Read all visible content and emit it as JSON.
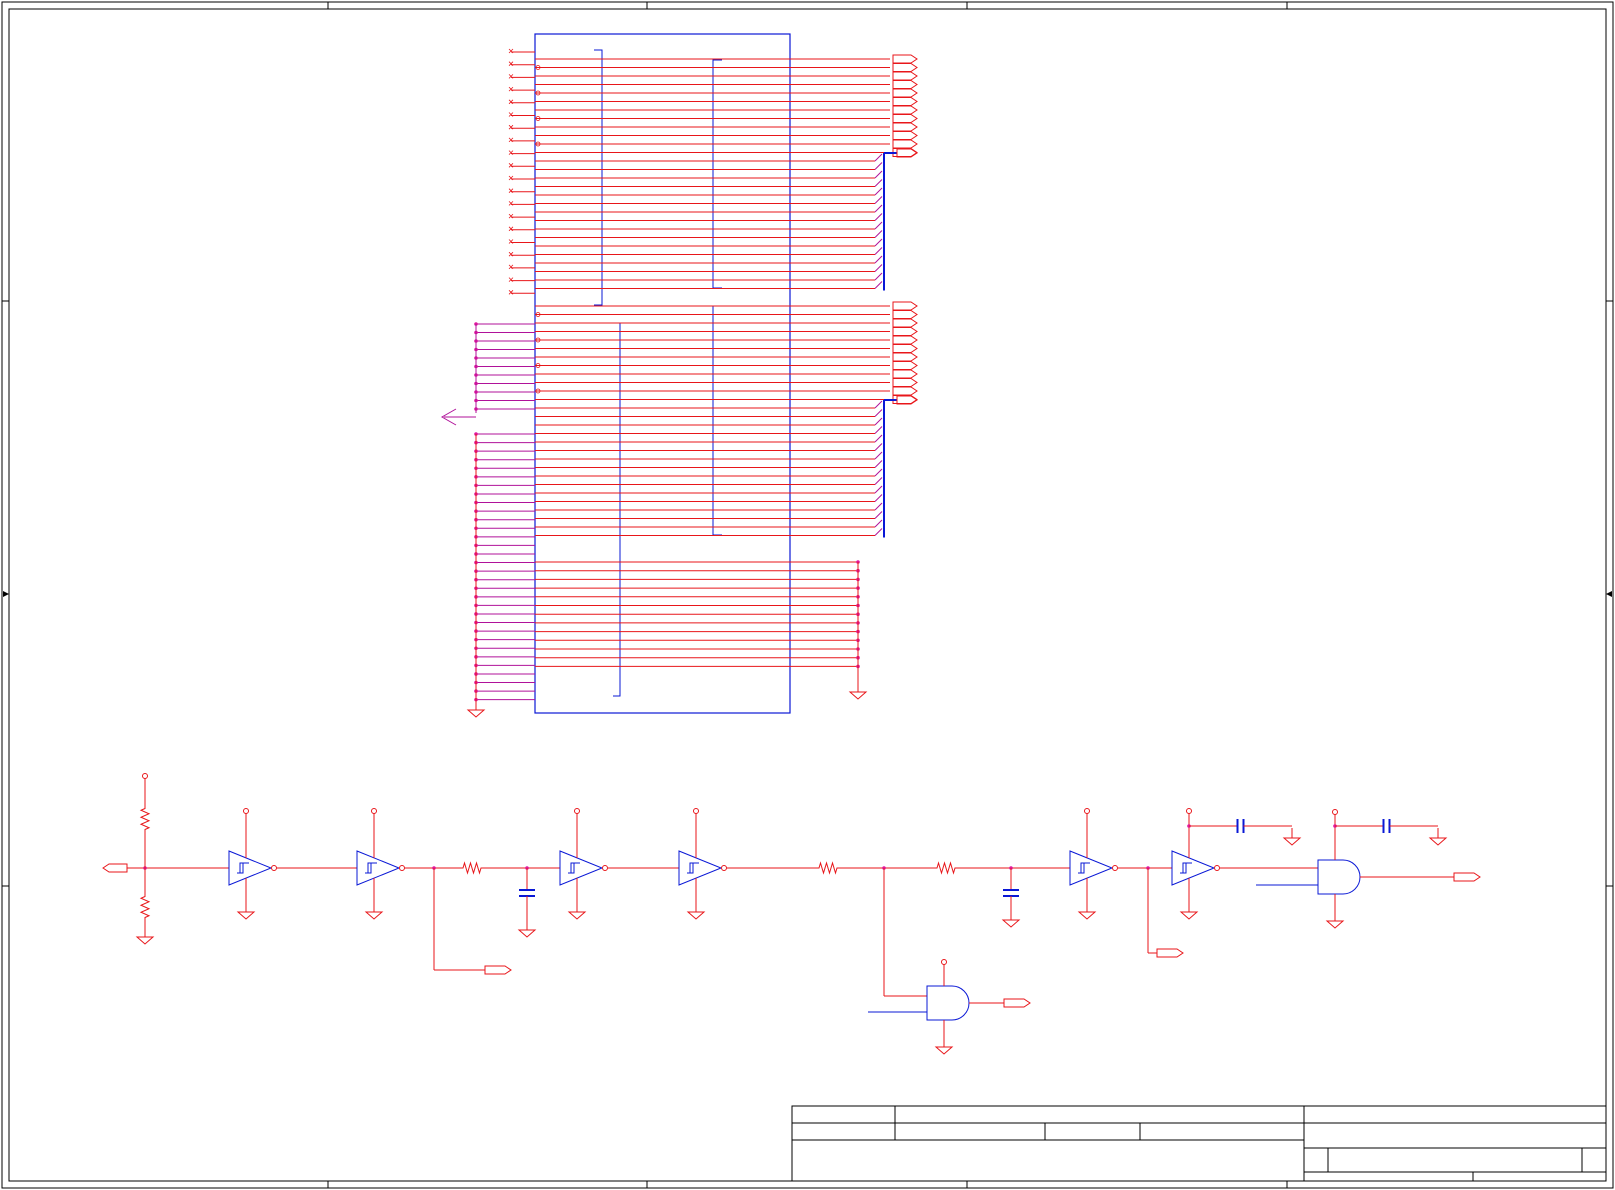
{
  "colors": {
    "wire": "#e8161a",
    "component": "#0a18d6",
    "ground_net": "#b0129a",
    "junction": "#e0169e",
    "frame": "#000000",
    "background": "#ffffff"
  },
  "sheet": {
    "has_zone_ticks": true,
    "has_title_block": true
  },
  "components": {
    "connector": {
      "name": "large-connector-symbol",
      "left_pins_upper": 20,
      "left_pins_gnd_group_1": 11,
      "left_pins_gnd_group_2": 32,
      "right_pins_bus_a": 28,
      "right_pins_bus_b": 28,
      "right_pins_gnd_group": 13
    },
    "signal_chain": [
      "port",
      "resistor-divider",
      "schmitt-buffer",
      "schmitt-buffer",
      "resistor",
      "capacitor",
      "schmitt-buffer",
      "schmitt-buffer",
      "resistor",
      "resistor",
      "capacitor",
      "schmitt-buffer",
      "schmitt-buffer",
      "and-gate",
      "and-gate"
    ],
    "icons": [
      "ground-icon",
      "power-pin-icon",
      "offpage-port-icon",
      "schmitt-buffer-icon",
      "and-gate-icon",
      "resistor-icon",
      "capacitor-icon"
    ]
  }
}
